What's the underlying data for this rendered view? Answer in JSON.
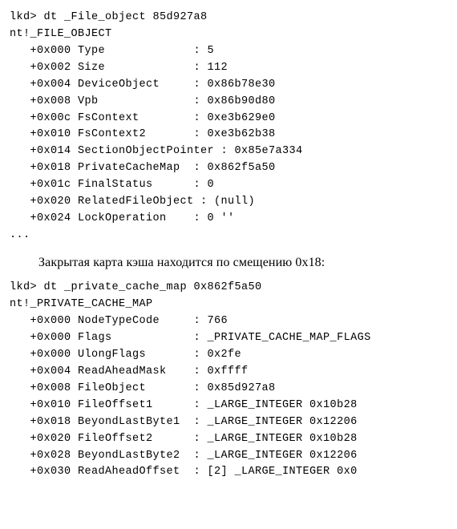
{
  "block1": {
    "prompt": "lkd> dt _File_object 85d927a8",
    "struct": "nt!_FILE_OBJECT",
    "lines": [
      "   +0x000 Type             : 5",
      "   +0x002 Size             : 112",
      "   +0x004 DeviceObject     : 0x86b78e30",
      "   +0x008 Vpb              : 0x86b90d80",
      "   +0x00c FsContext        : 0xe3b629e0",
      "   +0x010 FsContext2       : 0xe3b62b38",
      "   +0x014 SectionObjectPointer : 0x85e7a334",
      "   +0x018 PrivateCacheMap  : 0x862f5a50",
      "   +0x01c FinalStatus      : 0",
      "   +0x020 RelatedFileObject : (null)",
      "   +0x024 LockOperation    : 0 ''"
    ],
    "trailer": "..."
  },
  "prose1": "Закрытая карта кэша находится по смещению 0x18:",
  "block2": {
    "prompt": "lkd> dt _private_cache_map 0x862f5a50",
    "struct": "nt!_PRIVATE_CACHE_MAP",
    "lines": [
      "   +0x000 NodeTypeCode     : 766",
      "   +0x000 Flags            : _PRIVATE_CACHE_MAP_FLAGS",
      "   +0x000 UlongFlags       : 0x2fe",
      "   +0x004 ReadAheadMask    : 0xffff",
      "   +0x008 FileObject       : 0x85d927a8",
      "   +0x010 FileOffset1      : _LARGE_INTEGER 0x10b28",
      "   +0x018 BeyondLastByte1  : _LARGE_INTEGER 0x12206",
      "   +0x020 FileOffset2      : _LARGE_INTEGER 0x10b28",
      "   +0x028 BeyondLastByte2  : _LARGE_INTEGER 0x12206",
      "   +0x030 ReadAheadOffset  : [2] _LARGE_INTEGER 0x0"
    ]
  }
}
